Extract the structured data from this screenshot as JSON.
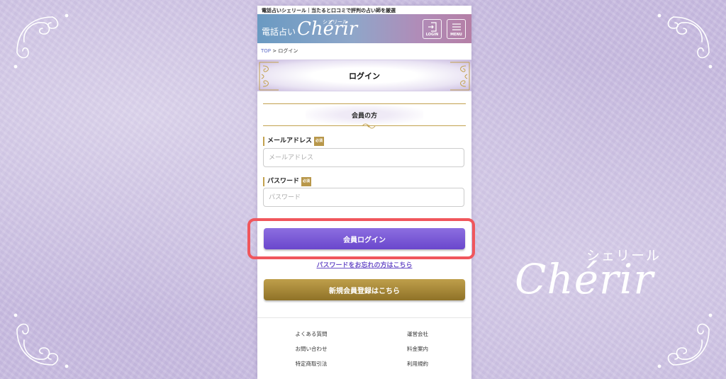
{
  "site": {
    "tagline": "電話占いシェリール｜当たると口コミで評判の占い師を厳選",
    "logo_prefix": "電話占い",
    "logo_script": "Chérir",
    "logo_kana": "シェリール"
  },
  "header": {
    "login_caption": "LOGIN",
    "menu_caption": "MENU"
  },
  "breadcrumb": {
    "top": "TOP",
    "separator": ">",
    "current": "ログイン"
  },
  "page_title": "ログイン",
  "member_heading": "会員の方",
  "form": {
    "email_label": "メールアドレス",
    "email_placeholder": "メールアドレス",
    "email_value": "",
    "password_label": "パスワード",
    "password_placeholder": "パスワード",
    "password_value": "",
    "required_badge": "必須",
    "login_button": "会員ログイン",
    "forgot_link": "パスワードをお忘れの方はこちら",
    "register_button": "新規会員登録はこちら"
  },
  "footer": {
    "links": [
      [
        "よくある質問",
        "運営会社"
      ],
      [
        "お問い合わせ",
        "料金案内"
      ],
      [
        "特定商取引法",
        "利用規約"
      ]
    ]
  },
  "brand_overlay": {
    "script": "Chérir",
    "kana": "シェリール"
  },
  "colors": {
    "accent_purple": "#6a47cc",
    "accent_gold": "#b8974a",
    "highlight": "#f0565c"
  },
  "icons": [
    "corner-flourish-icon",
    "login-door-icon",
    "menu-hamburger-icon",
    "ornament-icon"
  ]
}
